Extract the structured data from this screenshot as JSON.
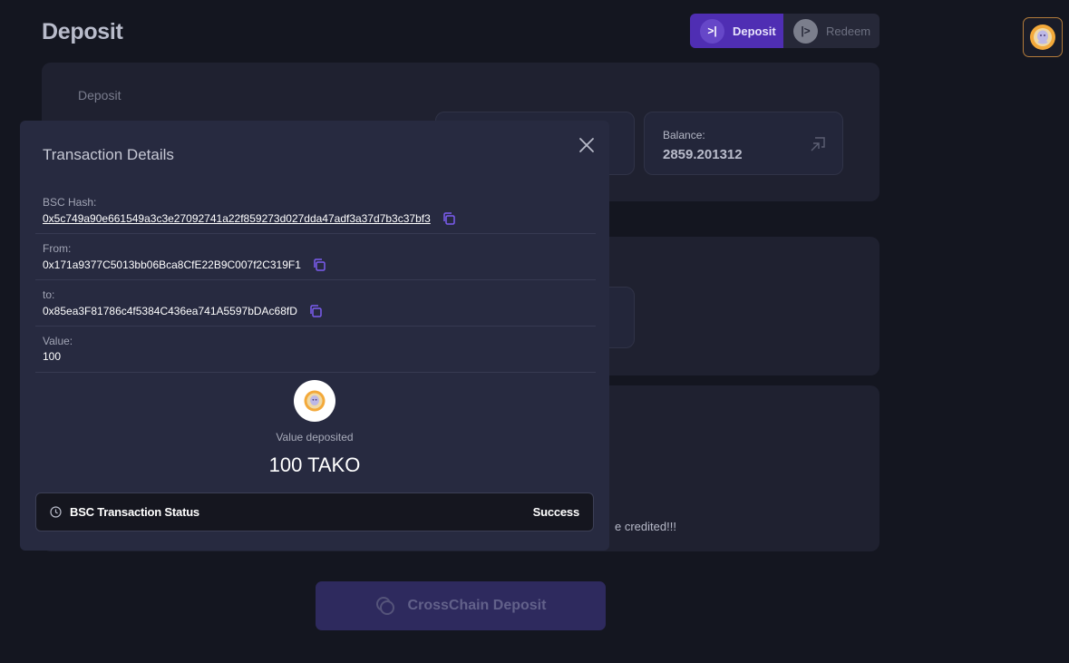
{
  "page": {
    "title": "Deposit"
  },
  "mode_toggle": {
    "deposit": {
      "label": "Deposit",
      "icon": "deposit-icon",
      "active": true
    },
    "redeem": {
      "label": "Redeem",
      "icon": "redeem-icon",
      "active": false
    }
  },
  "account": {
    "avatar_icon": "tako-avatar-icon"
  },
  "deposit_panel": {
    "label": "Deposit",
    "balance": {
      "label": "Balance:",
      "value": "2859.201312"
    }
  },
  "notice": {
    "text": "e credited!!!"
  },
  "cross_chain_button": {
    "label": "CrossChain Deposit",
    "icon": "crosschain-icon"
  },
  "modal": {
    "title": "Transaction Details",
    "rows": [
      {
        "label": "BSC Hash:",
        "value": "0x5c749a90e661549a3c3e27092741a22f859273d027dda47adf3a37d7b3c37bf3"
      },
      {
        "label": "From:",
        "value": "0x171a9377C5013bb06Bca8CfE22B9C007f2C319F1"
      },
      {
        "label": "to:",
        "value": "0x85ea3F81786c4f5384C436ea741A5597bDAc68fD"
      },
      {
        "label": "Value:",
        "value": "100"
      }
    ],
    "value_deposited_label": "Value deposited",
    "value_deposited_amount": "100 TAKO",
    "status": {
      "label": "BSC Transaction Status",
      "value": "Success"
    }
  },
  "colors": {
    "background": "#141620",
    "panel": "#1f2130",
    "modal": "#272a40",
    "accent": "#4f2eb3",
    "copy_icon": "#7b5cf0"
  }
}
